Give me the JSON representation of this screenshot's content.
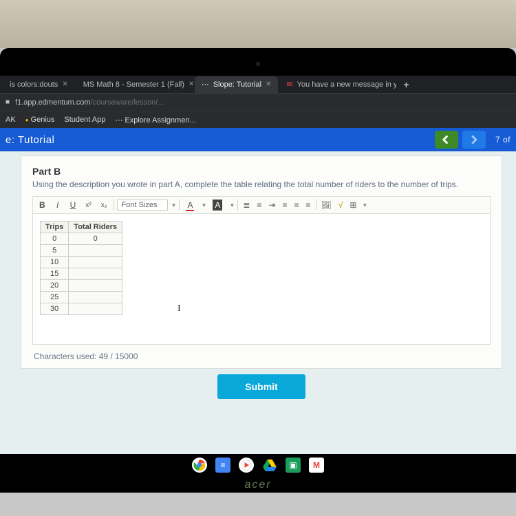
{
  "tabs": [
    {
      "label": "is colors:douts",
      "active": false
    },
    {
      "label": "MS Math 8 - Semester 1 (Fall)",
      "active": false
    },
    {
      "label": "Slope: Tutorial",
      "active": true
    },
    {
      "label": "You have a new message in y",
      "active": false
    }
  ],
  "url": {
    "host": "f1.app.edmentum.com",
    "path": "/courseware/lesson/..."
  },
  "bookmarks": [
    "AK",
    "Genius",
    "Student App",
    "Explore Assignmen..."
  ],
  "tutorial_bar": {
    "title": "e: Tutorial",
    "page": "7 of "
  },
  "part": {
    "title": "Part B",
    "desc": "Using the description you wrote in part A, complete the table relating the total number of riders to the number of trips."
  },
  "toolbar": {
    "font_sizes": "Font Sizes"
  },
  "table": {
    "headers": [
      "Trips",
      "Total Riders"
    ],
    "rows": [
      [
        "0",
        "0"
      ],
      [
        "5",
        ""
      ],
      [
        "10",
        ""
      ],
      [
        "15",
        ""
      ],
      [
        "20",
        ""
      ],
      [
        "25",
        ""
      ],
      [
        "30",
        ""
      ]
    ]
  },
  "char_count": "Characters used: 49 / 15000",
  "submit": "Submit",
  "brand": "acer"
}
